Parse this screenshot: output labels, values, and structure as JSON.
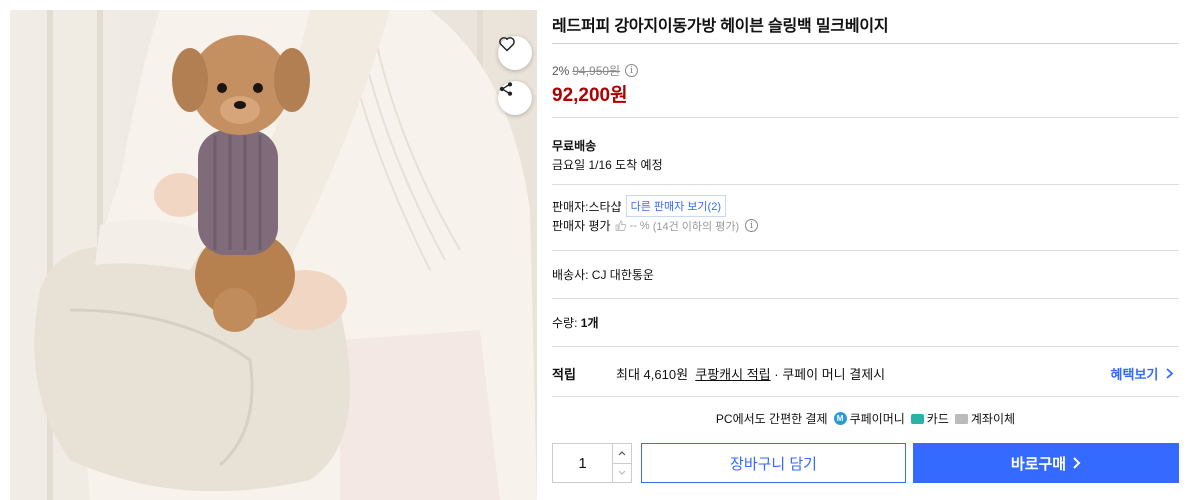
{
  "product": {
    "title": "레드퍼피 강아지이동가방 헤이븐 슬링백 밀크베이지",
    "image_alt": "강아지 이동가방 슬링백 착용 사진"
  },
  "icons": {
    "wishlist": "heart-icon",
    "share": "share-icon",
    "info": "info-icon",
    "thumb": "thumb-up-icon",
    "chevron": "chevron-right-icon"
  },
  "price": {
    "discount_rate": "2%",
    "original_price": "94,950원",
    "sale_price": "92,200원",
    "info_glyph": "i"
  },
  "shipping": {
    "title": "무료배송",
    "arrival": "금요일 1/16 도착 예정"
  },
  "seller": {
    "label": "판매자:",
    "name": "스타샵",
    "other_sellers_button": "다른 판매자 보기(2)",
    "rating_label": "판매자 평가",
    "rating_value": "-- %",
    "rating_note": "(14건 이하의 평가)"
  },
  "courier": "배송사:  CJ 대한통운",
  "quantity_info": {
    "label": "수량:",
    "value": "1개"
  },
  "points": {
    "label": "적립",
    "max_text": "최대 4,610원",
    "cash_link": "쿠팡캐시 적립",
    "suffix": "· 쿠페이 머니 결제시",
    "benefit_link": "혜택보기"
  },
  "payment": {
    "intro": "PC에서도 간편한 결제",
    "methods": {
      "coupay": "쿠페이머니",
      "card": "카드",
      "bank": "계좌이체"
    },
    "coupay_glyph": "M"
  },
  "purchase": {
    "quantity": "1",
    "cart_button": "장바구니 담기",
    "buy_button": "바로구매"
  },
  "colors": {
    "accent_blue": "#346aff",
    "price_red": "#ae0000"
  }
}
